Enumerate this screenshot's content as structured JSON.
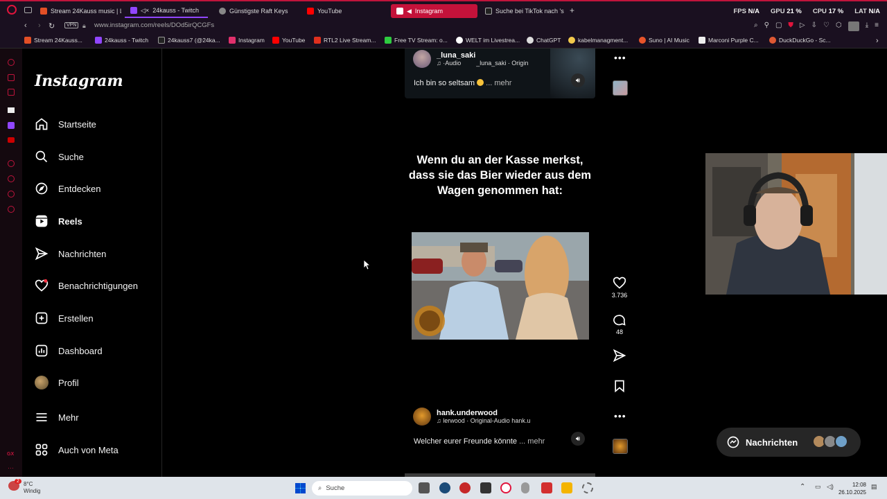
{
  "browser": {
    "tabs": [
      {
        "label": "Stream 24Kauss music | L",
        "color": "#e34f26"
      },
      {
        "label": "24kauss - Twitch",
        "color": "#9146ff"
      },
      {
        "label": "Günstigste Raft Keys",
        "color": "#888888"
      },
      {
        "label": "YouTube",
        "color": "#ff0000"
      },
      {
        "label": "Instagram",
        "color": "#e1306c"
      },
      {
        "label": "Suche bei TikTok nach 's",
        "color": "#222222"
      }
    ],
    "new_tab": "+",
    "perf": {
      "fps_label": "FPS",
      "fps": "N/A",
      "gpu_label": "GPU",
      "gpu": "21 %",
      "cpu_label": "CPU",
      "cpu": "17 %",
      "lat_label": "LAT",
      "lat": "N/A"
    },
    "url": "www.instagram.com/reels/DOd5irQCGFs",
    "vpn": "VPN",
    "bookmarks": [
      "Stream 24Kauss...",
      "24kauss - Twitch",
      "24kauss7 (@24ka...",
      "Instagram",
      "YouTube",
      "RTL2 Live Stream...",
      "Free TV Stream: o...",
      "WELT im Livestrea...",
      "ChatGPT",
      "kabelmanagment...",
      "Suno | AI Music",
      "Marconi Purple C...",
      "DuckDuckGo - Sc..."
    ]
  },
  "instagram": {
    "logo": "Instagram",
    "nav": [
      {
        "label": "Startseite",
        "icon": "home-icon"
      },
      {
        "label": "Suche",
        "icon": "search-icon"
      },
      {
        "label": "Entdecken",
        "icon": "compass-icon"
      },
      {
        "label": "Reels",
        "icon": "reels-icon"
      },
      {
        "label": "Nachrichten",
        "icon": "send-icon"
      },
      {
        "label": "Benachrichtigungen",
        "icon": "heart-icon"
      },
      {
        "label": "Erstellen",
        "icon": "plus-square-icon"
      },
      {
        "label": "Dashboard",
        "icon": "dashboard-icon"
      },
      {
        "label": "Profil",
        "icon": "avatar"
      },
      {
        "label": "Mehr",
        "icon": "menu-icon"
      },
      {
        "label": "Auch von Meta",
        "icon": "meta-icon"
      }
    ]
  },
  "reels": {
    "top": {
      "username": "_luna_saki",
      "audio_left": "·Audio",
      "audio_right": "_luna_saki · Origin",
      "caption": "Ich bin so seltsam",
      "more": "... mehr"
    },
    "main": {
      "overlay_text": "Wenn du an der Kasse merkst, dass sie das Bier wieder aus dem Wagen genommen hat:",
      "likes": "3.736",
      "comments": "48"
    },
    "next": {
      "username": "hank.underwood",
      "audio": "lerwood · Original-Audio  hank.u",
      "caption": "Welcher eurer Freunde könnte",
      "more": "... mehr"
    }
  },
  "messages_pill": {
    "label": "Nachrichten"
  },
  "taskbar": {
    "notif_count": "2",
    "temp": "8°C",
    "weather": "Windig",
    "search": "Suche",
    "time": "12:08",
    "date": "26.10.2025"
  }
}
